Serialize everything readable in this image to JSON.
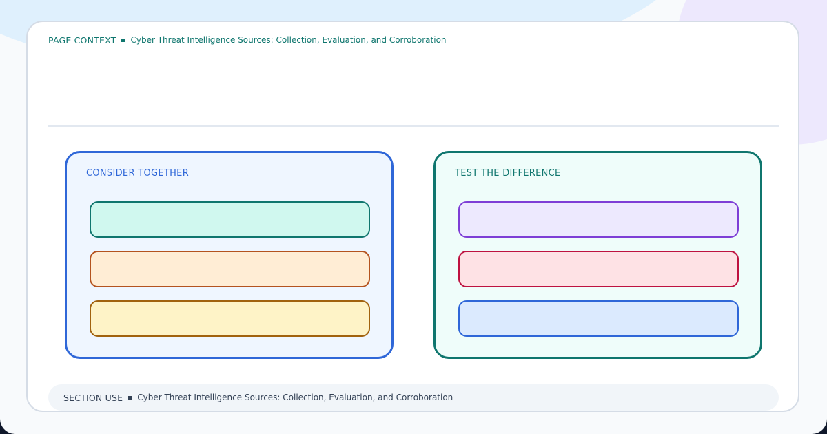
{
  "header": {
    "context_label": "PAGE CONTEXT",
    "context_text": "Cyber Threat Intelligence Sources: Collection, Evaluation, and Corroboration"
  },
  "panels": [
    {
      "title": "CONSIDER TOGETHER",
      "accent": "#2f67d8",
      "slots": [
        {
          "fill": "#d0f8ef",
          "border": "#0f766e"
        },
        {
          "fill": "#ffedd5",
          "border": "#b4531f"
        },
        {
          "fill": "#fef3c7",
          "border": "#a1620e"
        }
      ]
    },
    {
      "title": "TEST THE DIFFERENCE",
      "accent": "#0f766e",
      "slots": [
        {
          "fill": "#ede9fe",
          "border": "#7e3ed6"
        },
        {
          "fill": "#fee2e5",
          "border": "#be1240"
        },
        {
          "fill": "#dbeafe",
          "border": "#2f67d8"
        }
      ]
    }
  ],
  "footer": {
    "label": "SECTION USE",
    "text": "Cyber Threat Intelligence Sources: Collection, Evaluation, and Corroboration"
  }
}
